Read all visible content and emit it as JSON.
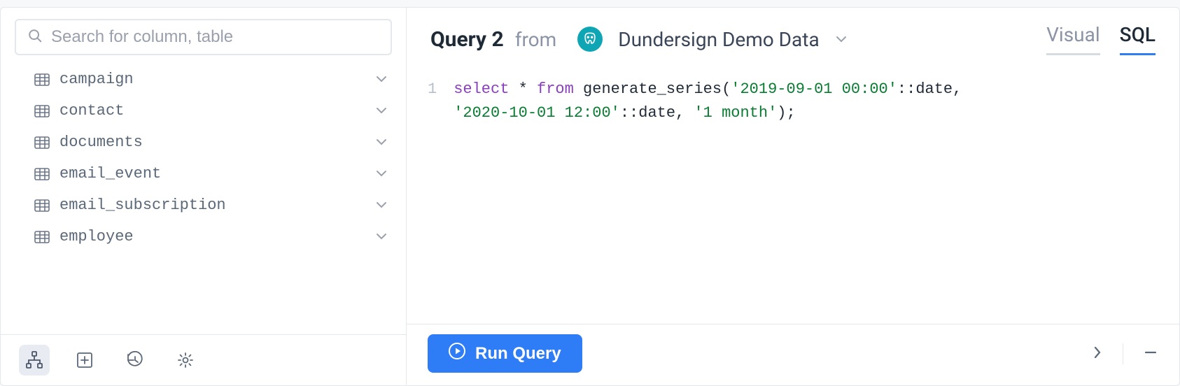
{
  "sidebar": {
    "search_placeholder": "Search for column, table",
    "tables": [
      {
        "name": "campaign"
      },
      {
        "name": "contact"
      },
      {
        "name": "documents"
      },
      {
        "name": "email_event"
      },
      {
        "name": "email_subscription"
      },
      {
        "name": "employee"
      }
    ]
  },
  "header": {
    "title": "Query 2",
    "from_label": "from",
    "datasource": "Dundersign Demo Data",
    "tabs": {
      "visual": "Visual",
      "sql": "SQL",
      "active": "sql"
    }
  },
  "editor": {
    "line_number": "1",
    "tokens": {
      "kw_select": "select",
      "star": " * ",
      "kw_from": "from",
      "fn": " generate_series(",
      "str1": "'2019-09-01 00:00'",
      "cast1": "::date, ",
      "str2": "'2020-10-01 12:00'",
      "cast2": "::date, ",
      "str3": "'1 month'",
      "end": ");"
    }
  },
  "footer": {
    "run_label": "Run Query"
  }
}
